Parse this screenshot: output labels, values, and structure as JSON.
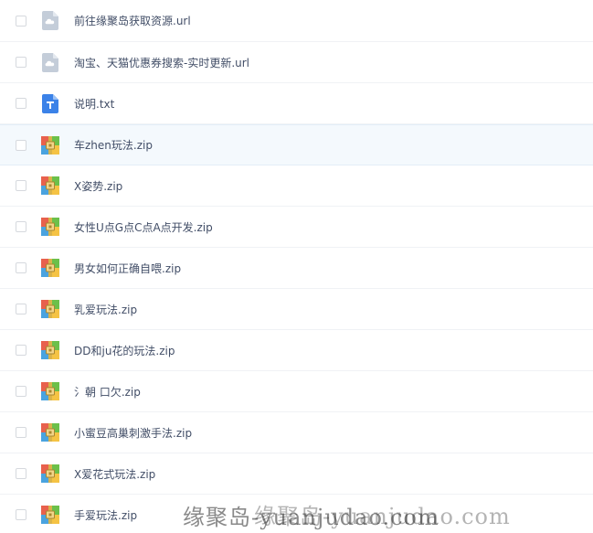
{
  "files": [
    {
      "name": "前往缘聚岛获取资源.url",
      "icon": "cloud-url-icon",
      "type": "url"
    },
    {
      "name": "淘宝、天猫优惠券搜索-实时更新.url",
      "icon": "cloud-url-icon",
      "type": "url"
    },
    {
      "name": "说明.txt",
      "icon": "text-file-icon",
      "type": "txt"
    },
    {
      "name": "车zhen玩法.zip",
      "icon": "zip-archive-icon",
      "type": "zip"
    },
    {
      "name": "X姿势.zip",
      "icon": "zip-archive-icon",
      "type": "zip"
    },
    {
      "name": "女性U点G点C点A点开发.zip",
      "icon": "zip-archive-icon",
      "type": "zip"
    },
    {
      "name": "男女如何正确自喂.zip",
      "icon": "zip-archive-icon",
      "type": "zip"
    },
    {
      "name": "乳爱玩法.zip",
      "icon": "zip-archive-icon",
      "type": "zip"
    },
    {
      "name": "DD和ju花的玩法.zip",
      "icon": "zip-archive-icon",
      "type": "zip"
    },
    {
      "name": "氵朝 口欠.zip",
      "icon": "zip-archive-icon",
      "type": "zip"
    },
    {
      "name": "小蜜豆高巢刺激手法.zip",
      "icon": "zip-archive-icon",
      "type": "zip"
    },
    {
      "name": "X爱花式玩法.zip",
      "icon": "zip-archive-icon",
      "type": "zip"
    },
    {
      "name": "手爱玩法.zip",
      "icon": "zip-archive-icon",
      "type": "zip"
    }
  ],
  "hovered_index": 3,
  "watermark": {
    "text": "缘聚岛-yuanjudao.com",
    "ghost_text": "缘聚岛-yuanjudao.com"
  },
  "colors": {
    "text": "#424e67",
    "hover_row": "#f4f9fd",
    "cloud_icon": "#c4cdd9",
    "txt_icon": "#3b82e8",
    "zip_red": "#e8614d",
    "zip_green": "#6cc04a",
    "zip_blue": "#4aa3df",
    "zip_yellow": "#f5c344"
  }
}
